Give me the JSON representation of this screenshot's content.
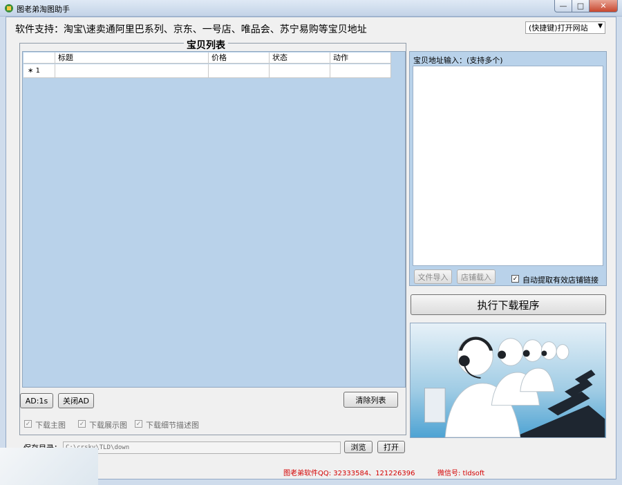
{
  "window": {
    "title": "图老弟淘图助手",
    "controls": {
      "minimize": "—",
      "maximize": "□",
      "close": "✕"
    }
  },
  "header": {
    "support_text": "软件支持：淘宝\\速卖通阿里巴系列、京东、一号店、唯品会、苏宁易购等宝贝地址",
    "site_select": {
      "selected": "(快捷键)打开网站"
    }
  },
  "item_list": {
    "title": "宝贝列表",
    "columns": [
      "标题",
      "价格",
      "状态",
      "动作"
    ],
    "rows": [
      {
        "marker": "∗",
        "number": "1",
        "title": "",
        "price": "",
        "status": "",
        "action": ""
      }
    ]
  },
  "left_buttons": {
    "ad_timer": "AD:1s",
    "close_ad": "关闭AD",
    "clear_list": "清除列表"
  },
  "download_options": [
    {
      "label": "下载主图",
      "checked": true
    },
    {
      "label": "下载展示图",
      "checked": true
    },
    {
      "label": "下载细节描述图",
      "checked": true
    }
  ],
  "save": {
    "label": "保存目录：",
    "path": "C:\\crsky\\TLD\\down",
    "browse": "浏览",
    "open": "打开"
  },
  "url_panel": {
    "label": "宝贝地址输入：(支持多个)",
    "value": "",
    "import_file": "文件导入",
    "store_load": "店铺载入",
    "auto_extract": {
      "label": "自动提取有效店铺链接",
      "checked": true
    }
  },
  "execute_button": "执行下载程序",
  "status": {
    "qq": "图老弟软件QQ: 32333584、121226396",
    "wechat": "微信号: tldsoft"
  },
  "colors": {
    "grid_bg": "#b9d2ea",
    "status_text": "#d40000"
  }
}
